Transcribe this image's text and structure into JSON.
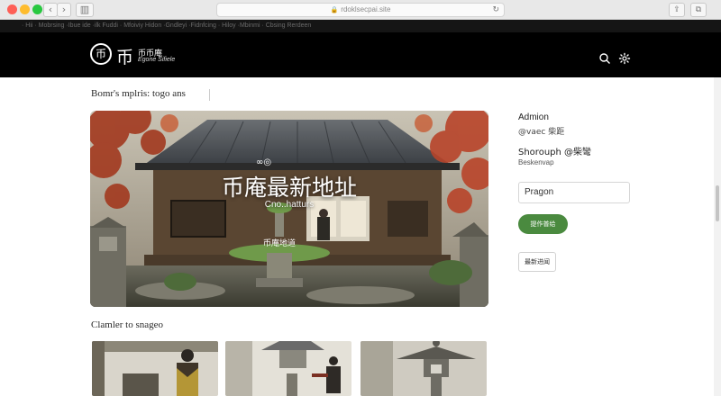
{
  "browser": {
    "address": "rdoklsecpai.site",
    "back_icon": "chevron-left-icon",
    "forward_icon": "chevron-right-icon",
    "sidebar_icon": "sidebar-icon",
    "share_icon": "share-icon",
    "tabs_icon": "tabs-icon",
    "reload_icon": "reload-icon",
    "lock_icon": "lock-icon"
  },
  "bookmarks_text": "· Hii · Mobrsing ·Ibue ide ·ilk Fuddi · Mfoiviy Hidon ·Gndleyi ·Fidnfcing · Hiloy ·Mbinmi · Cbsing Rerdeen",
  "header": {
    "logo_mark": "币",
    "logo_cn": "币",
    "logo_title": "币币庵",
    "logo_subtitle": "Egone Sifiele",
    "search_icon": "search-icon",
    "menu_icon": "gear-icon"
  },
  "main": {
    "subtitle": "Bomr's mplris: togo ans",
    "hero": {
      "title": "币庵最新地址",
      "subtitle": "Cno..hatturs",
      "stone_label": "币庵地道",
      "icon": "link-icon"
    },
    "section_title": "Clamler to snageo"
  },
  "side": {
    "name": "Admion",
    "handle": "@vaec 柴距",
    "status": "Shorouph @柴彎",
    "note": "Beskenvap",
    "input_value": "Pragon",
    "button_label": "提作普给",
    "link_label": "最新进闻"
  },
  "colors": {
    "header_bg": "#000000",
    "accent_green": "#4a8a3f"
  }
}
